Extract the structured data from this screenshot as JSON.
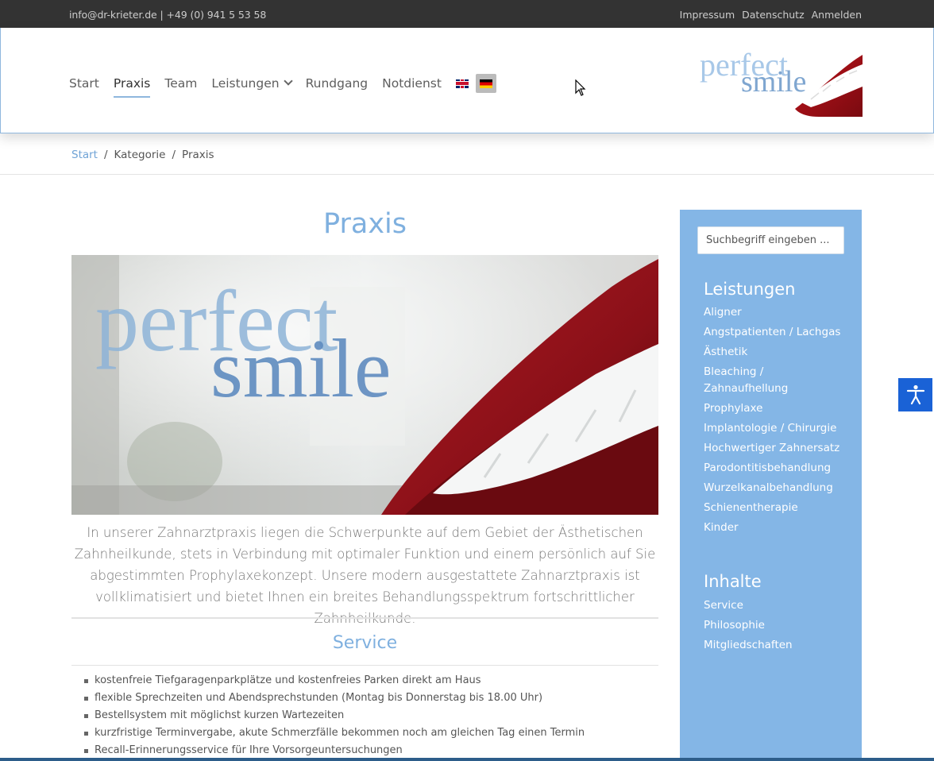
{
  "topbar": {
    "contact": "info@dr-krieter.de | +49 (0) 941 5 53 58",
    "links": [
      "Impressum",
      "Datenschutz",
      "Anmelden"
    ]
  },
  "nav": {
    "items": [
      "Start",
      "Praxis",
      "Team",
      "Leistungen",
      "Rundgang",
      "Notdienst"
    ],
    "active": "Praxis",
    "languages": [
      "en",
      "de"
    ]
  },
  "logo": {
    "line1": "perfect",
    "line2": "smile"
  },
  "breadcrumb": {
    "home": "Start",
    "category": "Kategorie",
    "current": "Praxis",
    "separator": "/"
  },
  "main": {
    "title": "Praxis",
    "intro": "In unserer Zahnarztpraxis liegen die Schwerpunkte auf dem Gebiet der Ästhetischen Zahnheilkunde, stets in Verbindung mit optimaler Funktion und einem persönlich auf Sie abgestimmten Prophylaxekonzept. Unsere modern ausgestattete Zahnarztpraxis ist vollklimatisiert und bietet Ihnen ein breites Behandlungsspektrum fortschrittlicher Zahnheilkunde.",
    "service_title": "Service",
    "service_items": [
      "kostenfreie Tiefgaragenparkplätze und kostenfreies Parken direkt am Haus",
      "flexible Sprechzeiten und Abendsprechstunden (Montag bis Donnerstag bis 18.00 Uhr)",
      "Bestellsystem mit möglichst kurzen Wartezeiten",
      "kurzfristige Terminvergabe, akute Schmerzfälle bekommen noch am gleichen Tag einen Termin",
      "Recall-Erinnerungsservice für Ihre Vorsorgeuntersuchungen"
    ]
  },
  "sidebar": {
    "search_placeholder": "Suchbegriff eingeben ...",
    "leistungen_heading": "Leistungen",
    "leistungen": [
      "Aligner",
      "Angstpatienten / Lachgas",
      "Ästhetik",
      "Bleaching / Zahnaufhellung",
      "Prophylaxe",
      "Implantologie / Chirurgie",
      "Hochwertiger Zahnersatz",
      "Parodontitisbehandlung",
      "Wurzelkanalbehandlung",
      "Schienentherapie",
      "Kinder"
    ],
    "inhalte_heading": "Inhalte",
    "inhalte": [
      "Service",
      "Philosophie",
      "Mitgliedschaften"
    ]
  },
  "colors": {
    "accent": "#7fb0df",
    "sidebar": "#84b6e6",
    "topbar": "#333333",
    "a11y": "#1a62d6"
  }
}
